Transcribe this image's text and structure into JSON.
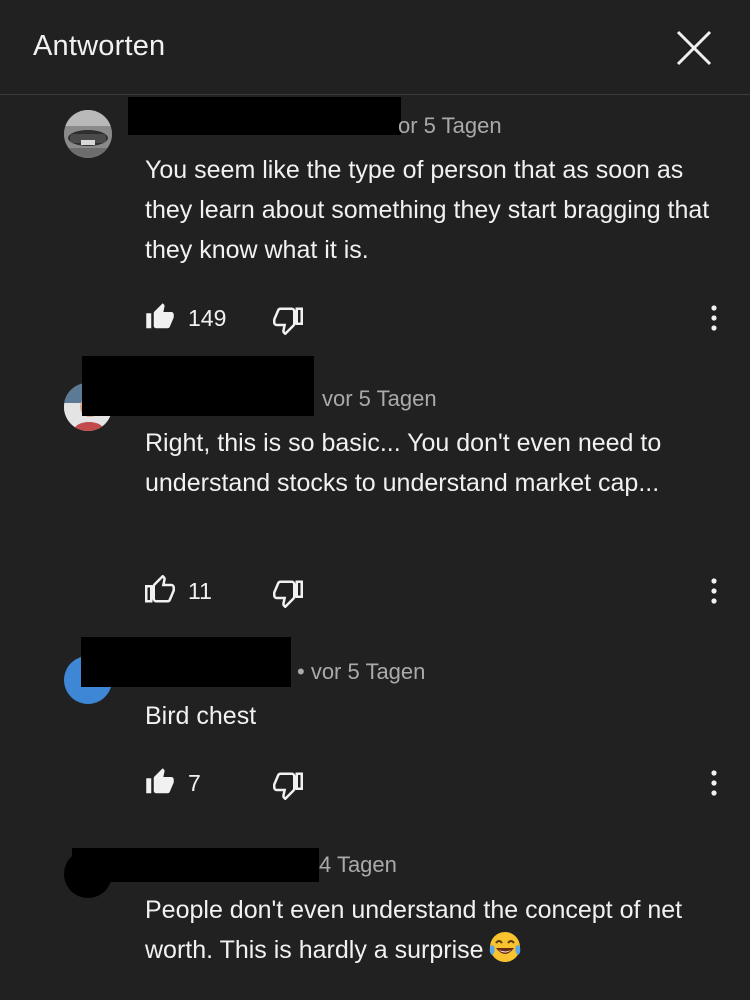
{
  "header": {
    "title": "Antworten"
  },
  "colors": {
    "background": "#212121",
    "text_primary": "#f1f1f1",
    "text_secondary": "#aaaaaa",
    "blue_avatar": "#3e86d6",
    "redaction": "#000000"
  },
  "comments": [
    {
      "time": "or 5 Tagen",
      "text": "You seem like the type of person that as soon as they learn about something they start bragging that they know what it is.",
      "likes": "149",
      "liked": true
    },
    {
      "time": "vor 5 Tagen",
      "text": "Right, this is so basic... You don't even need to understand stocks to understand market cap...",
      "likes": "11",
      "liked": false
    },
    {
      "time": "• vor 5 Tagen",
      "text": "Bird chest",
      "likes": "7",
      "liked": true
    },
    {
      "time": "4 Tagen",
      "text": "People don't even understand the concept of net worth. This is hardly a surprise",
      "emoji": "face-with-tears-of-joy"
    }
  ]
}
